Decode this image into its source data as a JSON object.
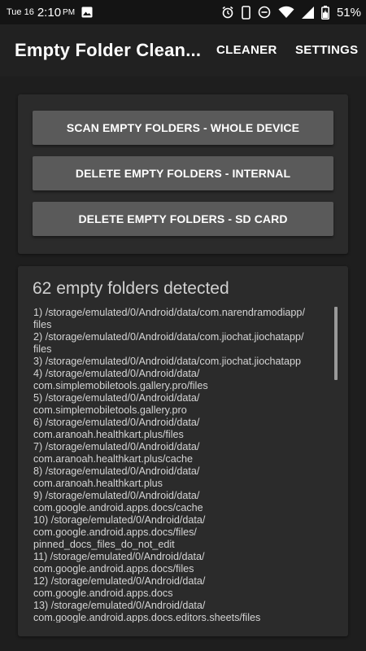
{
  "status_bar": {
    "day": "Tue 16",
    "time": "2:10",
    "ampm": "PM",
    "battery_percent": "51%",
    "icons": [
      "image-icon",
      "alarm-icon",
      "phone-icon",
      "do-not-disturb-icon",
      "wifi-icon",
      "signal-icon",
      "battery-icon"
    ]
  },
  "app_bar": {
    "title": "Empty Folder Clean...",
    "tabs": [
      {
        "label": "CLEANER"
      },
      {
        "label": "SETTINGS"
      }
    ]
  },
  "actions": {
    "scan_label": "SCAN EMPTY FOLDERS - WHOLE DEVICE",
    "delete_internal_label": "DELETE EMPTY FOLDERS - INTERNAL",
    "delete_sd_label": "DELETE EMPTY FOLDERS - SD CARD"
  },
  "results": {
    "heading": "62 empty folders detected",
    "entries": [
      "1) /storage/emulated/0/Android/data/com.narendramodiapp/\nfiles",
      "2) /storage/emulated/0/Android/data/com.jiochat.jiochatapp/\nfiles",
      "3) /storage/emulated/0/Android/data/com.jiochat.jiochatapp",
      "4) /storage/emulated/0/Android/data/\ncom.simplemobiletools.gallery.pro/files",
      "5) /storage/emulated/0/Android/data/\ncom.simplemobiletools.gallery.pro",
      "6) /storage/emulated/0/Android/data/\ncom.aranoah.healthkart.plus/files",
      "7) /storage/emulated/0/Android/data/\ncom.aranoah.healthkart.plus/cache",
      "8) /storage/emulated/0/Android/data/\ncom.aranoah.healthkart.plus",
      "9) /storage/emulated/0/Android/data/\ncom.google.android.apps.docs/cache",
      "10) /storage/emulated/0/Android/data/\ncom.google.android.apps.docs/files/\npinned_docs_files_do_not_edit",
      "11) /storage/emulated/0/Android/data/\ncom.google.android.apps.docs/files",
      "12) /storage/emulated/0/Android/data/\ncom.google.android.apps.docs",
      "13) /storage/emulated/0/Android/data/\ncom.google.android.apps.docs.editors.sheets/files"
    ]
  },
  "colors": {
    "background": "#1e1e1e",
    "app_bar": "#212121",
    "card": "#2b2b2b",
    "button": "#5a5a5a",
    "text": "#ffffff"
  }
}
